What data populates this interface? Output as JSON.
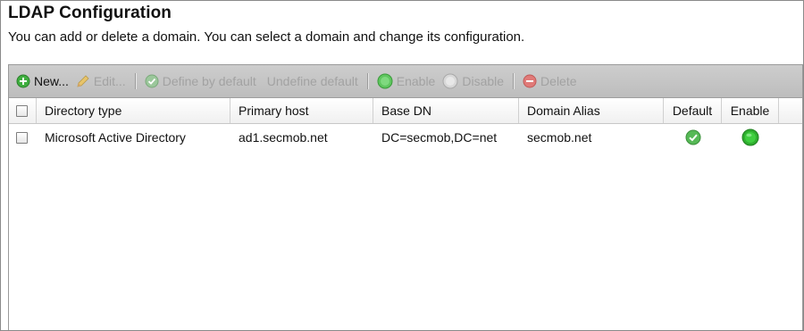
{
  "header": {
    "title": "LDAP Configuration",
    "subtitle": "You can add or delete a domain. You can select a domain and change its configuration."
  },
  "toolbar": {
    "new_label": "New...",
    "edit_label": "Edit...",
    "define_default_label": "Define by default",
    "undefine_default_label": "Undefine default",
    "enable_label": "Enable",
    "disable_label": "Disable",
    "delete_label": "Delete"
  },
  "table": {
    "columns": {
      "directory_type": "Directory type",
      "primary_host": "Primary host",
      "base_dn": "Base DN",
      "domain_alias": "Domain Alias",
      "default": "Default",
      "enable": "Enable"
    },
    "rows": [
      {
        "directory_type": "Microsoft Active Directory",
        "primary_host": "ad1.secmob.net",
        "base_dn": "DC=secmob,DC=net",
        "domain_alias": "secmob.net",
        "default": true,
        "enabled": true
      }
    ]
  },
  "colors": {
    "toolbar_bg": "#c4c4c4",
    "enabled_green": "#2fae2f",
    "delete_red": "#d9534f",
    "disabled_text": "#a2a2a2"
  },
  "icons": {
    "new": "plus-circle-icon",
    "edit": "pencil-icon",
    "define_default": "check-circle-icon",
    "enable": "green-dot-icon",
    "disable": "grey-dot-icon",
    "delete": "minus-circle-icon"
  }
}
